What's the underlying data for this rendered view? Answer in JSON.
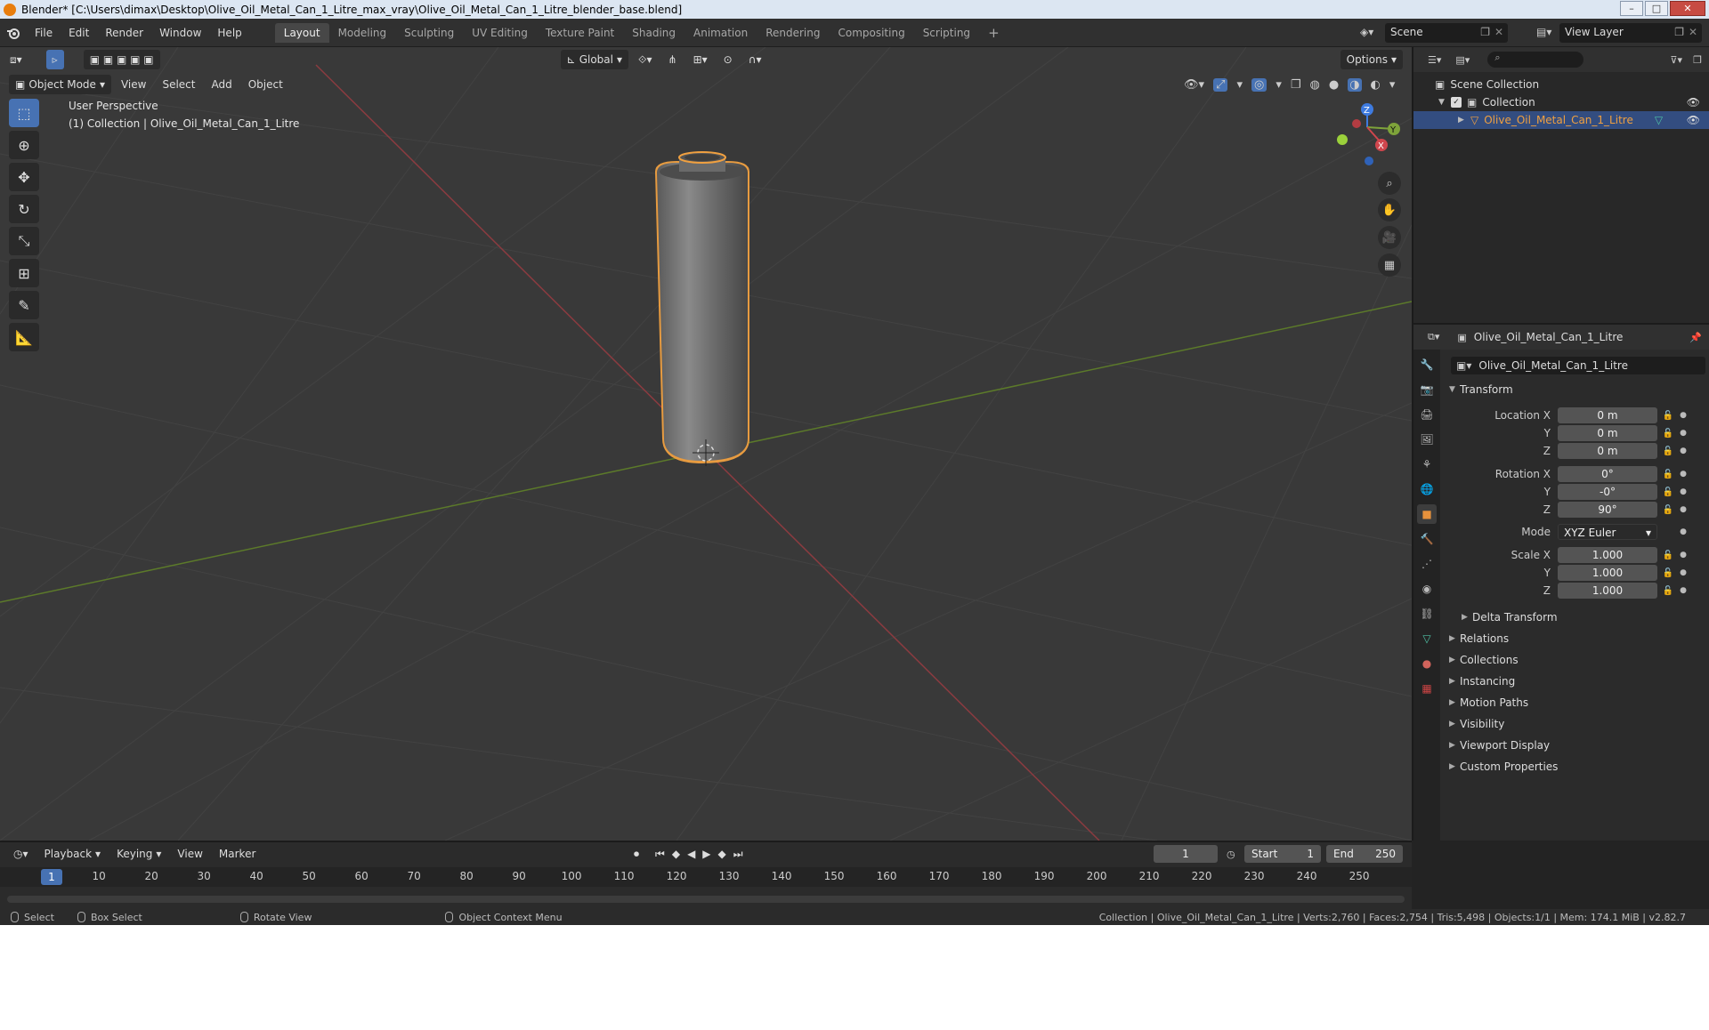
{
  "window": {
    "title": "Blender* [C:\\Users\\dimax\\Desktop\\Olive_Oil_Metal_Can_1_Litre_max_vray\\Olive_Oil_Metal_Can_1_Litre_blender_base.blend]",
    "minimize": "–",
    "maximize": "□",
    "close": "✕"
  },
  "menu": [
    "File",
    "Edit",
    "Render",
    "Window",
    "Help"
  ],
  "workspaces": [
    "Layout",
    "Modeling",
    "Sculpting",
    "UV Editing",
    "Texture Paint",
    "Shading",
    "Animation",
    "Rendering",
    "Compositing",
    "Scripting"
  ],
  "add_workspace": "+",
  "scene": {
    "name": "Scene",
    "view_layer": "View Layer"
  },
  "viewport": {
    "transform_orientation": "Global",
    "options": "Options",
    "mode": "Object Mode",
    "menus": [
      "View",
      "Select",
      "Add",
      "Object"
    ],
    "info_line1": "User Perspective",
    "info_line2": "(1) Collection | Olive_Oil_Metal_Can_1_Litre",
    "axis_x": "X",
    "axis_y": "Y",
    "axis_z": "Z"
  },
  "outliner": {
    "root": "Scene Collection",
    "collection": "Collection",
    "object": "Olive_Oil_Metal_Can_1_Litre"
  },
  "properties": {
    "object_name": "Olive_Oil_Metal_Can_1_Litre",
    "data_name": "Olive_Oil_Metal_Can_1_Litre",
    "transform_title": "Transform",
    "location_label": "Location X",
    "rotation_label": "Rotation X",
    "scale_label": "Scale X",
    "y_label": "Y",
    "z_label": "Z",
    "mode_label": "Mode",
    "location": [
      "0 m",
      "0 m",
      "0 m"
    ],
    "rotation": [
      "0°",
      "-0°",
      "90°"
    ],
    "mode": "XYZ Euler",
    "scale": [
      "1.000",
      "1.000",
      "1.000"
    ],
    "sections": [
      "Delta Transform",
      "Relations",
      "Collections",
      "Instancing",
      "Motion Paths",
      "Visibility",
      "Viewport Display",
      "Custom Properties"
    ]
  },
  "timeline": {
    "menus": [
      "Playback",
      "Keying",
      "View",
      "Marker"
    ],
    "current_frame": "1",
    "start_label": "Start",
    "start": "1",
    "end_label": "End",
    "end": "250",
    "ticks": [
      "10",
      "20",
      "30",
      "40",
      "50",
      "60",
      "70",
      "80",
      "90",
      "100",
      "110",
      "120",
      "130",
      "140",
      "150",
      "160",
      "170",
      "180",
      "190",
      "200",
      "210",
      "220",
      "230",
      "240",
      "250"
    ]
  },
  "status": {
    "select": "Select",
    "box_select": "Box Select",
    "rotate_view": "Rotate View",
    "context_menu": "Object Context Menu",
    "stats": "Collection | Olive_Oil_Metal_Can_1_Litre | Verts:2,760 | Faces:2,754 | Tris:5,498 | Objects:1/1 | Mem: 174.1 MiB | v2.82.7"
  },
  "colors": {
    "accent_blue": "#4772b3",
    "selection_orange": "#f0a040",
    "x_axis": "#d0464d",
    "y_axis": "#7ea33a",
    "z_axis": "#3e7be0"
  }
}
